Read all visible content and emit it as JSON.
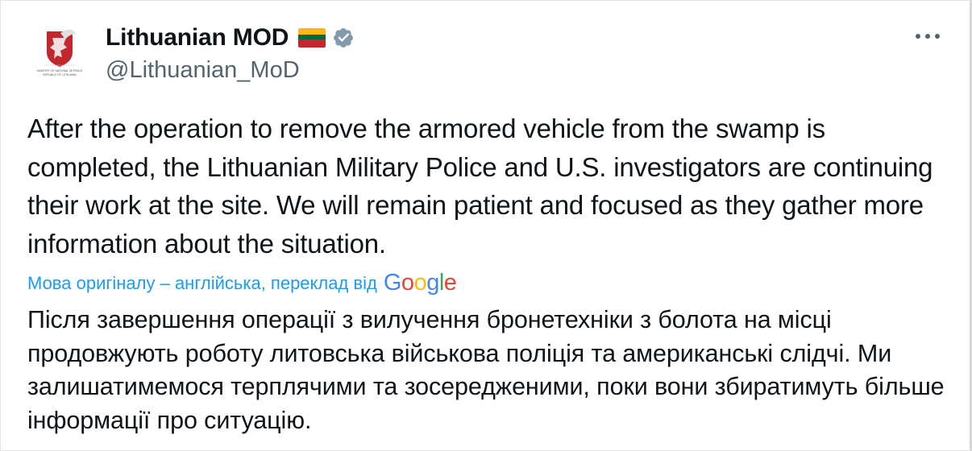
{
  "author": {
    "display_name": "Lithuanian MOD",
    "handle": "@Lithuanian_MoD",
    "avatar_caption_line1": "MINISTRY OF NATIONAL DEFENCE",
    "avatar_caption_line2": "REPUBLIC OF LITHUANIA",
    "flag_icon": "lithuania-flag-emoji",
    "verified_icon": "gray-verified-badge"
  },
  "menu": {
    "more_label": "•••"
  },
  "tweet": {
    "text": "After the operation to remove the armored vehicle from the swamp is completed, the Lithuanian Military Police and U.S. investigators are continuing their work at the site. We will remain patient and focused as they gather more information about the situation."
  },
  "translation": {
    "label": "Мова оригіналу – англійська, переклад від",
    "provider_name": "Google",
    "text": "Після завершення операції з вилучення бронетехніки з болота на місці продовжують роботу литовська військова поліція та американські слідчі. Ми залишатимемося терплячими та зосередженими, поки вони збиратимуть більше інформації про ситуацію."
  },
  "colors": {
    "text_primary": "#0f1419",
    "text_secondary": "#536471",
    "link_blue": "#1d9bf0",
    "verified_gray": "#829aab",
    "flag_yellow": "#fdb913",
    "flag_green": "#006a44",
    "flag_red": "#c1272d",
    "google_blue": "#4285f4",
    "google_red": "#ea4335",
    "google_yellow": "#fbbc05",
    "google_green": "#34a853"
  }
}
